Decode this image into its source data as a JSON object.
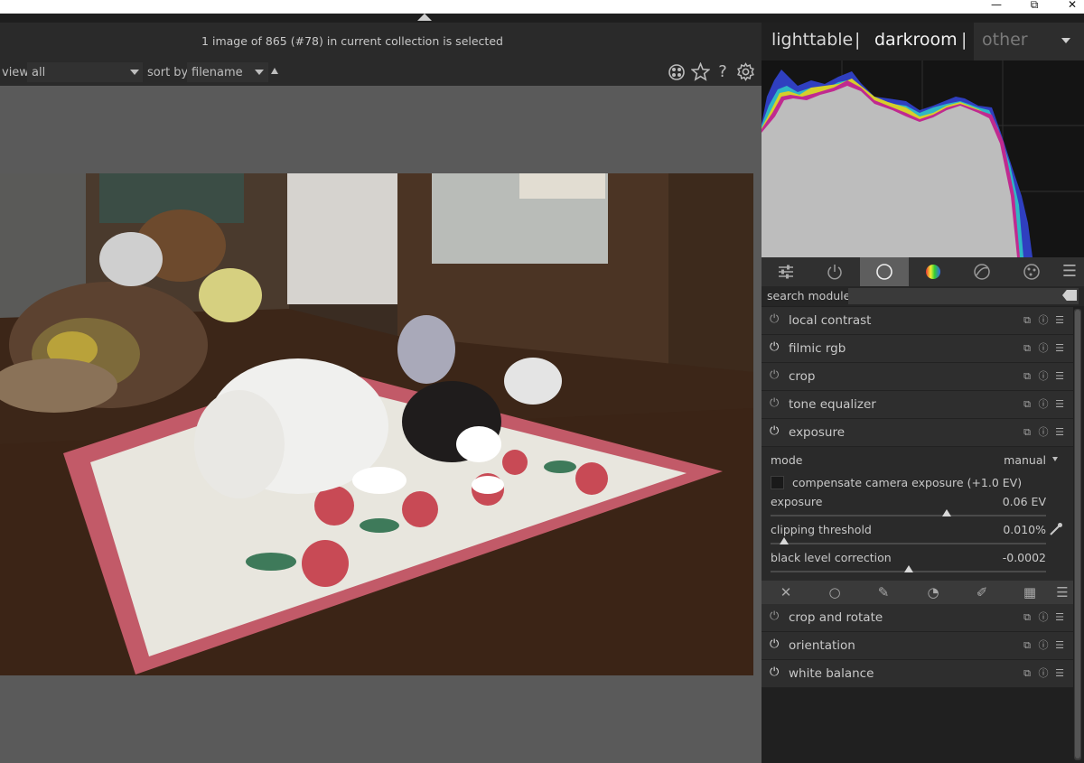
{
  "window": {
    "minimize_glyph": "—",
    "restore_glyph": "⧉",
    "close_glyph": "✕"
  },
  "header": {
    "status": "1 image of 865 (#78) in current collection is selected"
  },
  "filterbar": {
    "view_label": "view",
    "view_value": "all",
    "sort_label": "sort by",
    "sort_value": "filename",
    "icons": [
      "grouping-icon",
      "star-icon",
      "help-icon",
      "gear-icon"
    ]
  },
  "views": {
    "lighttable": "lighttable",
    "separator": "|",
    "darkroom": "darkroom",
    "other": "other"
  },
  "search": {
    "label": "search module"
  },
  "modules_top": [
    {
      "name": "local contrast",
      "on": false
    },
    {
      "name": "filmic rgb",
      "on": true
    },
    {
      "name": "crop",
      "on": false
    },
    {
      "name": "tone equalizer",
      "on": false
    },
    {
      "name": "exposure",
      "on": true
    }
  ],
  "exposure": {
    "mode_label": "mode",
    "mode_value": "manual",
    "compensate_label": "compensate camera exposure (+1.0 EV)",
    "compensate_checked": false,
    "params": [
      {
        "label": "exposure",
        "value": "0.06 EV",
        "position": 0.64
      },
      {
        "label": "clipping threshold",
        "value": "0.010%",
        "position": 0.05
      },
      {
        "label": "black level correction",
        "value": "-0.0002",
        "position": 0.5
      }
    ]
  },
  "modules_bottom": [
    {
      "name": "crop and rotate",
      "on": false
    },
    {
      "name": "orientation",
      "on": true
    },
    {
      "name": "white balance",
      "on": true
    }
  ],
  "colors": {
    "accent_active_tab": "#5e5e5e",
    "panel_bg": "#202020",
    "histogram_fill": "#bdbdbd"
  }
}
